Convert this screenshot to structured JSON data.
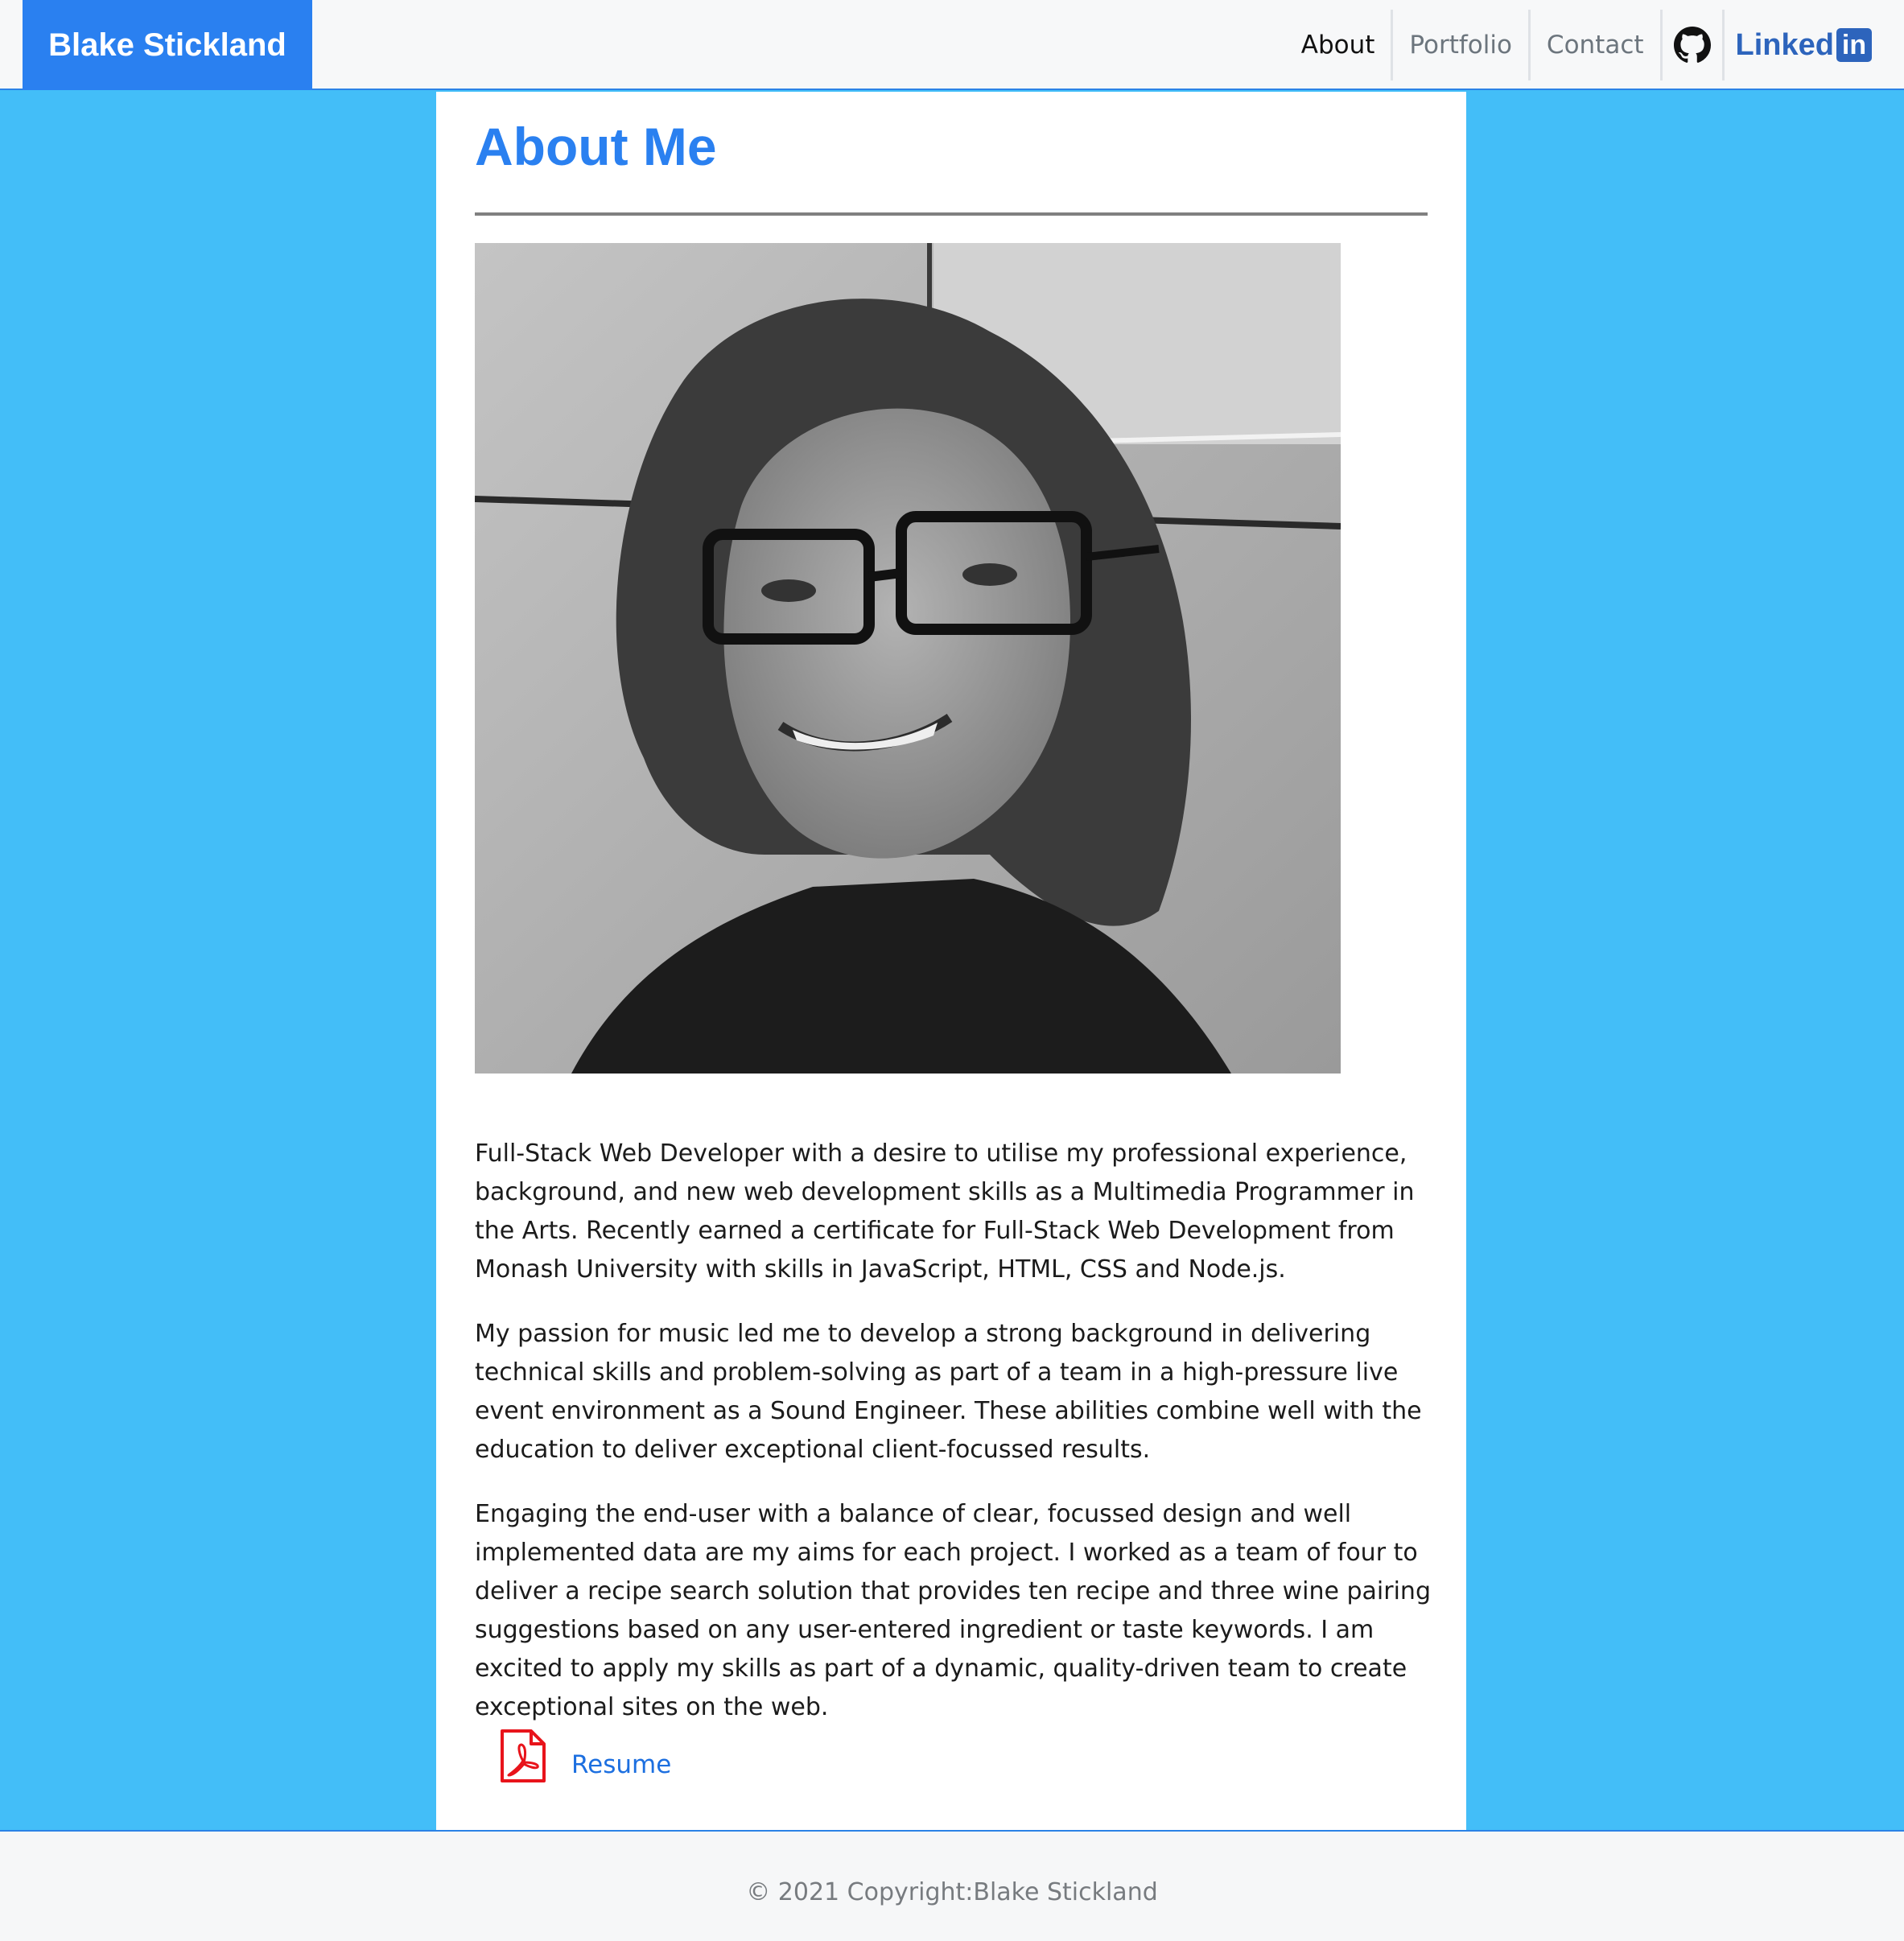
{
  "navbar": {
    "brand": "Blake Stickland",
    "links": {
      "about": "About",
      "portfolio": "Portfolio",
      "contact": "Contact"
    },
    "linkedin": {
      "word": "Linked",
      "box": "in"
    },
    "icons": [
      "github-icon",
      "linkedin-icon"
    ]
  },
  "main": {
    "title": "About Me",
    "bio": [
      "Full-Stack Web Developer with a desire to utilise my professional experience, background, and new web development skills as a Multimedia Programmer in the Arts. Recently earned a certificate for Full-Stack Web Development from Monash University with skills in JavaScript, HTML, CSS and Node.js.",
      "My passion for music led me to develop a strong background in delivering technical skills and problem-solving as part of a team in a high-pressure live event environment as a Sound Engineer. These abilities combine well with the education to deliver exceptional client-focussed results.",
      "Engaging the end-user with a balance of clear, focussed design and well implemented data are my aims for each project. I worked as a team of four to deliver a recipe search solution that provides ten recipe and three wine pairing suggestions based on any user-entered ingredient or taste keywords. I am excited to apply my skills as part of a dynamic, quality-driven team to create exceptional sites on the web."
    ],
    "resume": {
      "icon": "pdf-icon",
      "label": "Resume"
    }
  },
  "footer": {
    "copyright": "© 2021 Copyright:Blake Stickland"
  },
  "colors": {
    "brand_blue": "#2a80f0",
    "page_background": "#43bef8",
    "pdf_red": "#e8141b",
    "linkedin_blue": "#2d64bc"
  }
}
